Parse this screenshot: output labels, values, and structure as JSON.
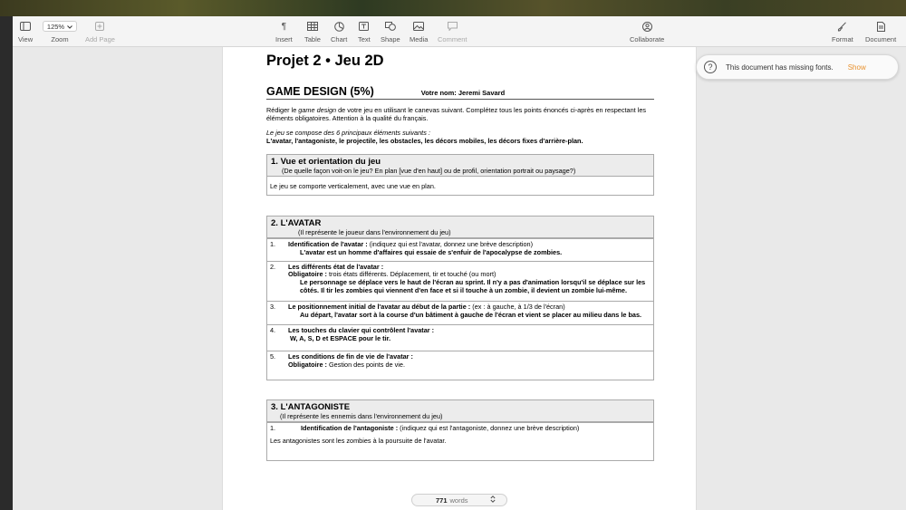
{
  "toolbar": {
    "left": [
      {
        "label": "View",
        "icon": "sidebar-icon"
      },
      {
        "label": "Zoom",
        "value": "125%",
        "icon": "chevron-down-icon"
      },
      {
        "label": "Add Page",
        "icon": "add-page-icon",
        "disabled": true
      }
    ],
    "center": [
      {
        "label": "Insert",
        "icon": "paragraph-icon"
      },
      {
        "label": "Table",
        "icon": "table-icon"
      },
      {
        "label": "Chart",
        "icon": "chart-icon"
      },
      {
        "label": "Text",
        "icon": "text-box-icon"
      },
      {
        "label": "Shape",
        "icon": "shape-icon"
      },
      {
        "label": "Media",
        "icon": "media-icon"
      },
      {
        "label": "Comment",
        "icon": "comment-icon",
        "disabled": true
      }
    ],
    "collaborate": {
      "label": "Collaborate",
      "icon": "collaborate-icon"
    },
    "right": [
      {
        "label": "Format",
        "icon": "paintbrush-icon"
      },
      {
        "label": "Document",
        "icon": "document-icon"
      }
    ]
  },
  "document": {
    "title": "Projet 2 • Jeu 2D",
    "design_title": "GAME DESIGN (5%)",
    "name_line": "Votre nom: Jeremi Savard",
    "intro_a": "Rédiger le ",
    "intro_em": "game design",
    "intro_b": " de votre jeu en utilisant le canevas suivant. Complétez tous les points énoncés ci-après en respectant les éléments obligatoires. Attention à la qualité du français.",
    "elements_intro": "Le jeu se compose des 6 principaux éléments suivants :",
    "elements_list": "L'avatar, l'antagoniste, le projectile, les obstacles, les décors mobiles, les décors fixes d'arrière-plan.",
    "sec1": {
      "number": "1.",
      "title": "Vue et orientation du jeu",
      "subtitle": "(De quelle façon voit-on le jeu? En plan [vue d'en haut] ou de profil, orientation portrait ou paysage?)",
      "answer": "Le jeu se comporte verticalement, avec une vue en plan."
    },
    "sec2": {
      "number": "2.",
      "title": "L'AVATAR",
      "subtitle": "(Il représente le joueur dans l'environnement du jeu)",
      "q1_num": "1.",
      "q1_label": "Identification de l'avatar :",
      "q1_hint": " (indiquez qui est l'avatar, donnez une brève description)",
      "q1_answer": "L'avatar est un homme d'affaires qui essaie de s'enfuir de l'apocalypse de zombies.",
      "q2_num": "2.",
      "q2_label": "Les différents état de l'avatar :",
      "q2_obl": "Obligatoire :",
      "q2_hint": " trois états différents. Déplacement, tir et touché (ou mort)",
      "q2_answer": "Le personnage se déplace vers le haut de l'écran au sprint. Il n'y a pas d'animation lorsqu'il se déplace sur les côtés. Il tir les zombies qui viennent d'en face et si il touche à un zombie, il devient un zombie lui-même.",
      "q3_num": "3.",
      "q3_label": "Le positionnement initial de l'avatar au début de la partie :",
      "q3_hint": " (ex : à gauche, à 1/3 de l'écran)",
      "q3_answer": "Au départ, l'avatar sort à la course d'un bâtiment à gauche de l'écran et vient se placer au milieu dans le bas.",
      "q4_num": "4.",
      "q4_label": "Les touches du clavier qui contrôlent l'avatar :",
      "q4_answer": "W, A, S, D et ESPACE pour le tir.",
      "q5_num": "5.",
      "q5_label": "Les conditions de fin de vie de l'avatar :",
      "q5_obl": "Obligatoire :",
      "q5_hint": " Gestion des points de vie."
    },
    "sec3": {
      "number": "3.",
      "title": "L'ANTAGONISTE",
      "subtitle": "(Il représente les ennemis dans l'environnement du jeu)",
      "q1_num": "1.",
      "q1_label": "Identification de l'antagoniste :",
      "q1_hint": " (indiquez qui est l'antagoniste, donnez une brève description)",
      "q1_answer": "Les antagonistes sont les zombies à la poursuite de l'avatar."
    }
  },
  "notice": {
    "message": "This document has missing fonts.",
    "action": "Show",
    "action_color": "#e8912d"
  },
  "wordcount": {
    "count": "771",
    "unit": "words"
  }
}
